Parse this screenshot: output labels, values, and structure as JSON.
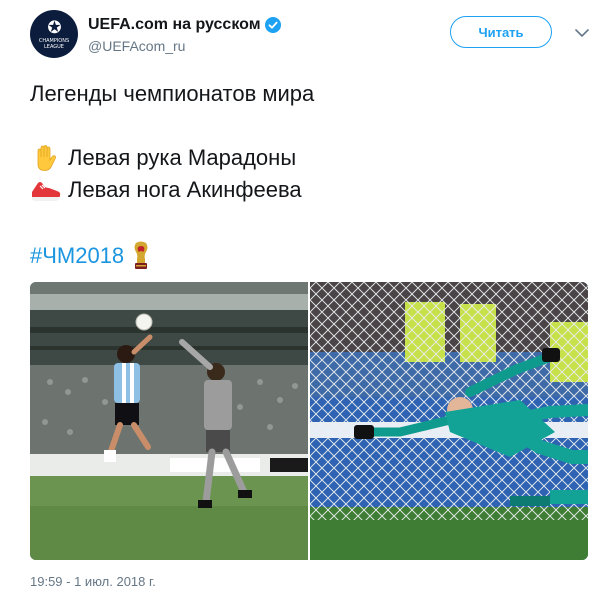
{
  "account": {
    "display_name": "UEFA.com на русском",
    "handle": "@UEFAcom_ru",
    "avatar_label": "CHAMPIONS LEAGUE",
    "verified": true
  },
  "actions": {
    "follow_label": "Читать",
    "more_icon": "chevron-down-icon"
  },
  "tweet": {
    "line1": "Легенды чемпионатов мира",
    "line2": "Левая рука Марадоны",
    "line2_emoji": "raised-hand-emoji",
    "line3": "Левая нога Акинфеева",
    "line3_emoji": "sneaker-emoji",
    "hashtag": "#ЧМ2018",
    "hashtag_emoji": "world-cup-trophy-emoji"
  },
  "media": {
    "photos": [
      {
        "name": "photo-maradona-hand"
      },
      {
        "name": "photo-akinfeev-save"
      }
    ]
  },
  "timestamp": "19:59 - 1 июл. 2018 г.",
  "colors": {
    "accent": "#1da1f2",
    "link": "#1b95e0",
    "secondary_text": "#657786",
    "primary_text": "#14171a"
  }
}
